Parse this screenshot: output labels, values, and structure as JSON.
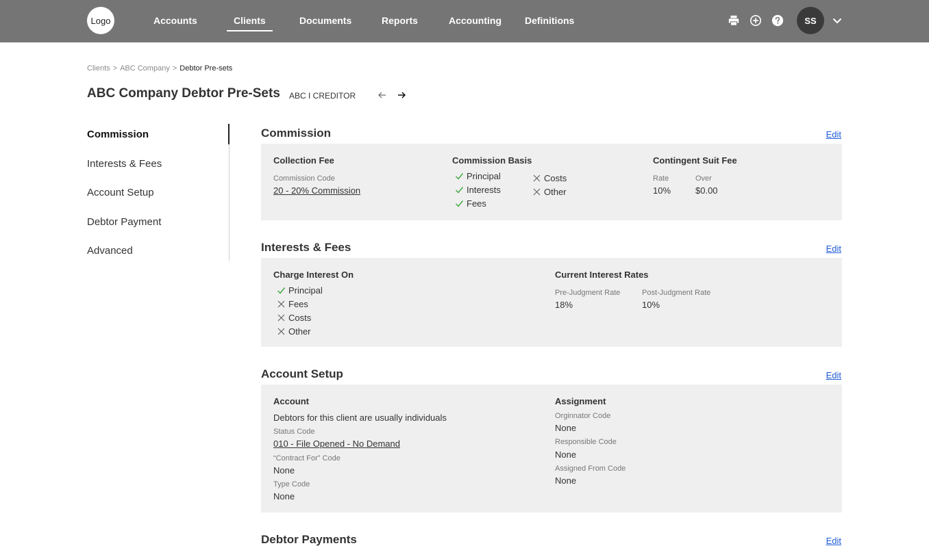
{
  "nav": {
    "logo": "Logo",
    "items": [
      {
        "label": "Accounts"
      },
      {
        "label": "Clients"
      },
      {
        "label": "Documents"
      },
      {
        "label": "Reports"
      },
      {
        "label": "Accounting"
      },
      {
        "label": "Definitions"
      }
    ],
    "active": "Clients",
    "icons": [
      "printer-icon",
      "plus-circle-icon",
      "help-icon",
      "chevron-down-icon"
    ],
    "avatar": "SS"
  },
  "breadcrumb": {
    "items": [
      "Clients",
      "ABC Company",
      "Debtor Pre-sets"
    ],
    "separator": ">"
  },
  "page": {
    "title": "ABC Company Debtor Pre-Sets",
    "subtitle": "ABC I CREDITOR"
  },
  "sidenav": {
    "items": [
      "Commission",
      "Interests & Fees",
      "Account Setup",
      "Debtor Payment",
      "Advanced"
    ],
    "active": "Commission"
  },
  "edit_label": "Edit",
  "commission": {
    "title": "Commission",
    "collection_fee": {
      "label": "Collection Fee",
      "code_label": "Commission Code",
      "code_value": "20 - 20% Commission"
    },
    "basis": {
      "label": "Commission Basis",
      "items": [
        {
          "text": "Principal",
          "checked": true
        },
        {
          "text": "Interests",
          "checked": true
        },
        {
          "text": "Fees",
          "checked": true
        },
        {
          "text": "Costs",
          "checked": false
        },
        {
          "text": "Other",
          "checked": false
        }
      ]
    },
    "contingent": {
      "label": "Contingent Suit Fee",
      "rate_label": "Rate",
      "rate_value": "10%",
      "over_label": "Over",
      "over_value": "$0.00"
    }
  },
  "interests": {
    "title": "Interests & Fees",
    "charge": {
      "label": "Charge Interest On",
      "items": [
        {
          "text": "Principal",
          "checked": true
        },
        {
          "text": "Fees",
          "checked": false
        },
        {
          "text": "Costs",
          "checked": false
        },
        {
          "text": "Other",
          "checked": false
        }
      ]
    },
    "rates": {
      "label": "Current Interest Rates",
      "pre_label": "Pre-Judgment Rate",
      "pre_value": "18%",
      "post_label": "Post-Judgment Rate",
      "post_value": "10%"
    }
  },
  "account_setup": {
    "title": "Account Setup",
    "account": {
      "label": "Account",
      "description": "Debtors for this client are usually individuals",
      "status_label": "Status Code",
      "status_value": "010 - File Opened - No Demand",
      "contract_label": "“Contract For” Code",
      "contract_value": "None",
      "type_label": "Type Code",
      "type_value": "None"
    },
    "assignment": {
      "label": "Assignment",
      "originator_label": "Orginnator Code",
      "originator_value": "None",
      "responsible_label": "Responsible Code",
      "responsible_value": "None",
      "assigned_label": "Assigned From Code",
      "assigned_value": "None"
    }
  },
  "debtor_payments": {
    "title": "Debtor Payments"
  },
  "colors": {
    "nav_bg": "#757575",
    "panel_bg": "#efefef",
    "link": "#1e5bd6",
    "check": "#3aa53a"
  }
}
